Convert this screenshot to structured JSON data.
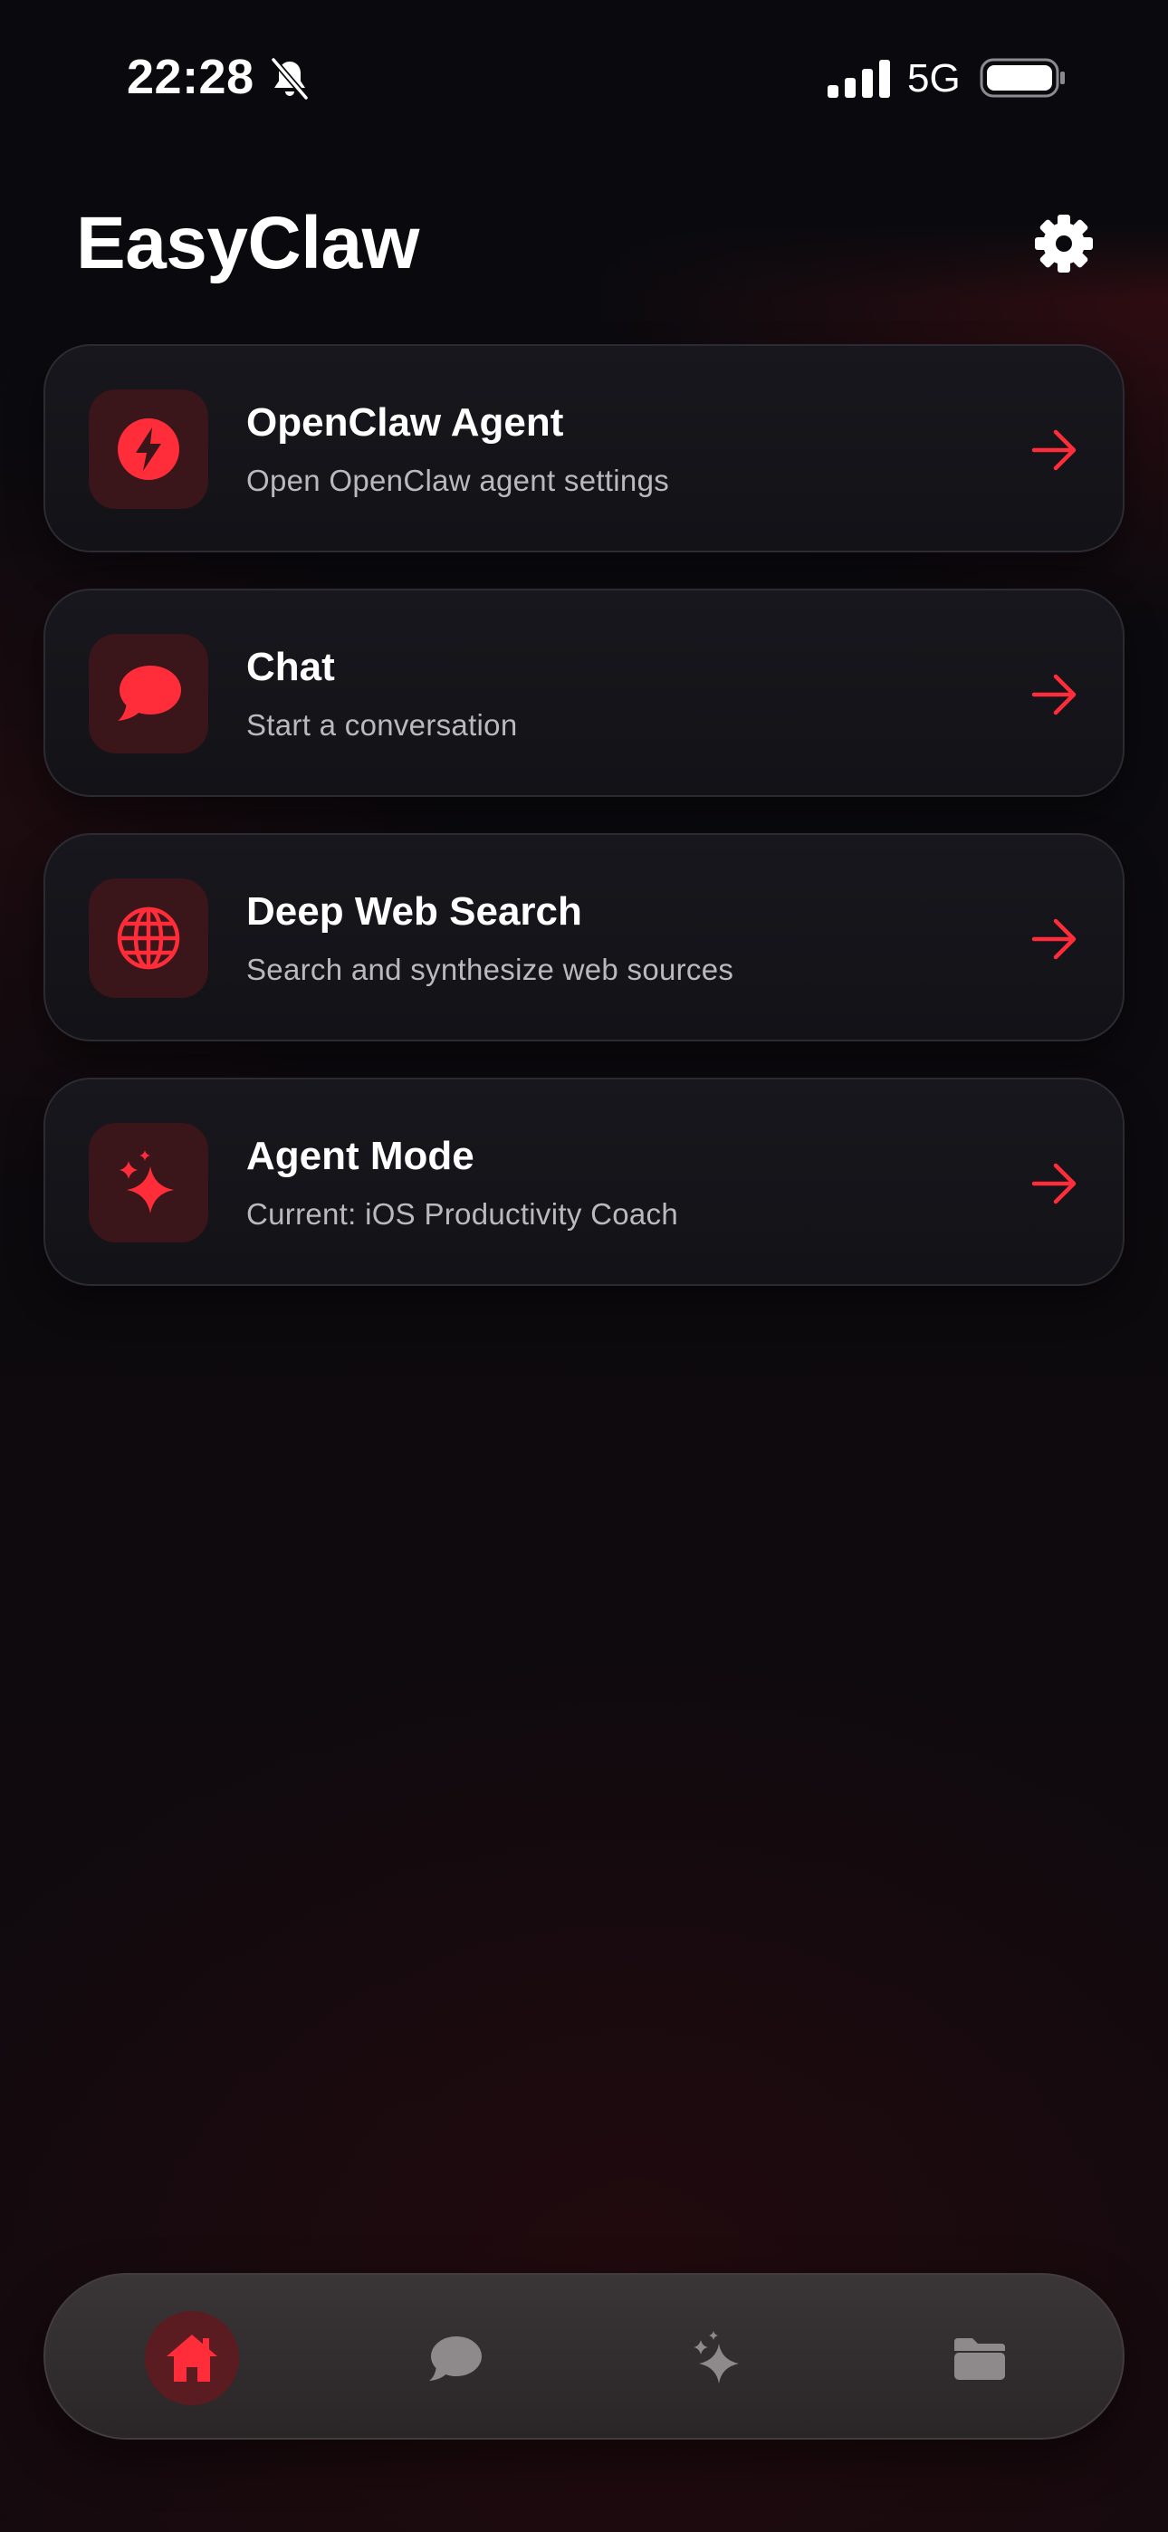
{
  "status_bar": {
    "time": "22:28",
    "network": "5G"
  },
  "header": {
    "title": "EasyClaw"
  },
  "cards": [
    {
      "title": "OpenClaw Agent",
      "subtitle": "Open OpenClaw agent settings",
      "icon": "bolt-icon"
    },
    {
      "title": "Chat",
      "subtitle": "Start a conversation",
      "icon": "chat-bubble-icon"
    },
    {
      "title": "Deep Web Search",
      "subtitle": "Search and synthesize web sources",
      "icon": "globe-icon"
    },
    {
      "title": "Agent Mode",
      "subtitle": "Current: iOS Productivity Coach",
      "icon": "sparkles-icon"
    }
  ],
  "tabbar": {
    "items": [
      {
        "icon": "home-icon",
        "active": true
      },
      {
        "icon": "chat-bubble-icon",
        "active": false
      },
      {
        "icon": "sparkles-icon",
        "active": false
      },
      {
        "icon": "folder-icon",
        "active": false
      }
    ]
  },
  "colors": {
    "accent": "#ff2d3a",
    "icon_tile": "#3a1519",
    "card_bg": "#15151a",
    "text_secondary": "#b9b9bf"
  }
}
